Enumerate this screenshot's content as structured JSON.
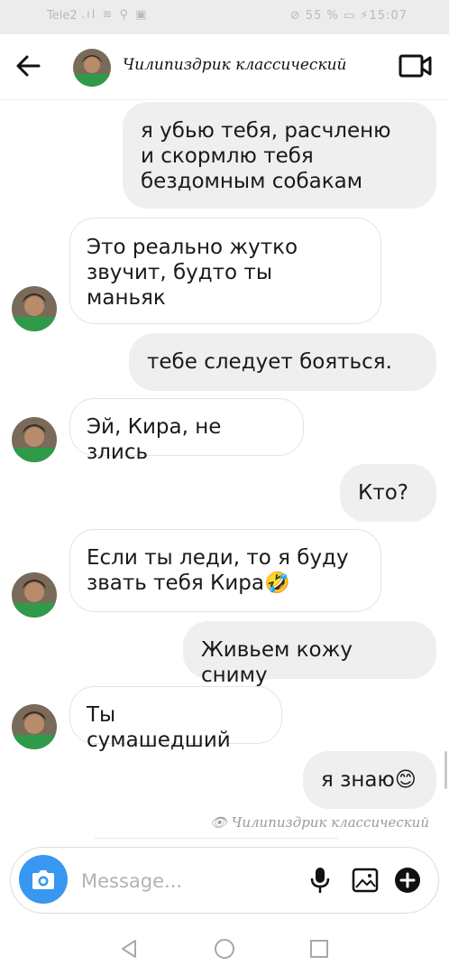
{
  "status_bar": {
    "carrier": "Tele2",
    "signal_glyphs": ".ıl ≋ ⚲ ▣",
    "right_text": "⊘ 55 % ▭ ⚡15:07"
  },
  "header": {
    "contact_name": "Чилипиздрик классический",
    "back_icon": "arrow-left-icon",
    "video_icon": "video-camera-icon"
  },
  "messages": [
    {
      "direction": "out",
      "text": "я убью тебя, расчленю\nи скормлю тебя\nбездомным собакам"
    },
    {
      "direction": "in",
      "text": "Это реально жутко\nзвучит, будто ты\nманьяк"
    },
    {
      "direction": "out",
      "text": "тебе следует бояться."
    },
    {
      "direction": "in",
      "text": "Эй, Кира, не злись"
    },
    {
      "direction": "out",
      "text": "Кто?"
    },
    {
      "direction": "in",
      "text": "Если ты леди, то я буду\nзвать тебя Кира🤣"
    },
    {
      "direction": "out",
      "text": "Живьем кожу сниму"
    },
    {
      "direction": "in",
      "text": "Ты сумашедший"
    },
    {
      "direction": "out",
      "text": "я знаю😊"
    }
  ],
  "seen_by": "Чилипиздрик классический",
  "composer": {
    "placeholder": "Message...",
    "value": ""
  },
  "colors": {
    "accent": "#3897f0",
    "outgoing_bubble": "#efefef",
    "incoming_border": "#e3e3e3"
  }
}
